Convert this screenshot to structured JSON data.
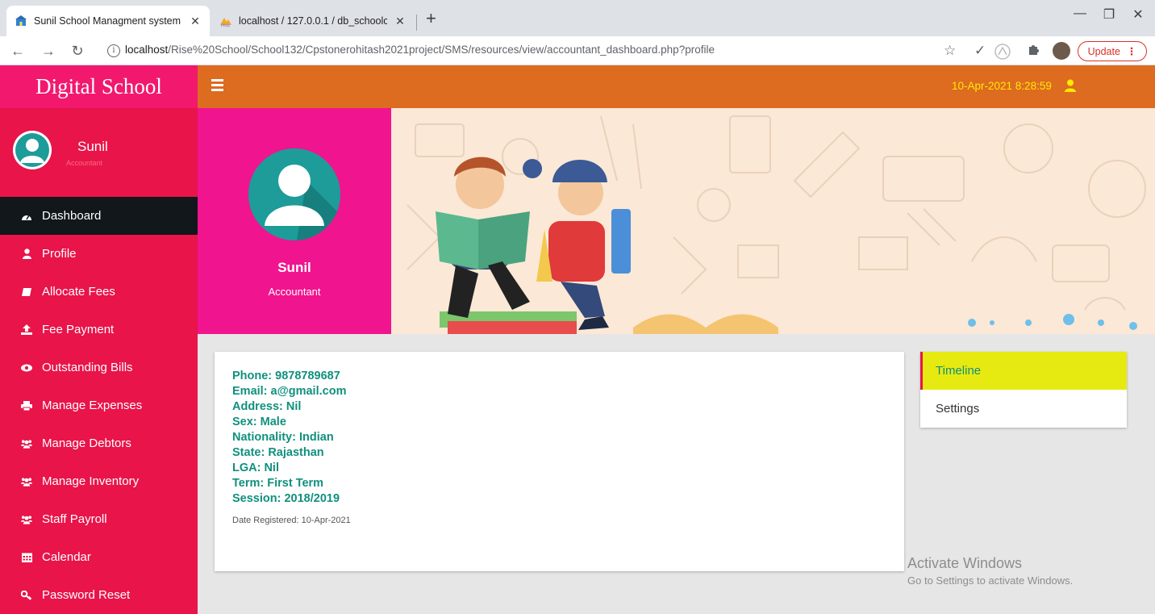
{
  "browser": {
    "tabs": [
      {
        "title": "Sunil School Managment system",
        "favicon": "school-icon",
        "active": true
      },
      {
        "title": "localhost / 127.0.0.1 / db_schoolc",
        "favicon": "phpmyadmin-icon",
        "active": false
      }
    ],
    "url_host": "localhost",
    "url_path": "/Rise%20School/School132/Cpstonerohitash2021project/SMS/resources/view/accountant_dashboard.php?profile",
    "update_label": "Update"
  },
  "app": {
    "brand": "Digital School",
    "datetime": "10-Apr-2021 8:28:59",
    "colors": {
      "brand": "#f2186e",
      "topbar": "#dd6b20",
      "sidebar": "#e8144a",
      "accent": "#10907d",
      "datetime": "#ffea00"
    }
  },
  "sidebar": {
    "user_name": "Sunil",
    "user_role": "Accountant",
    "items": [
      {
        "label": "Dashboard",
        "icon": "dashboard-icon",
        "active": true
      },
      {
        "label": "Profile",
        "icon": "user-icon"
      },
      {
        "label": "Allocate Fees",
        "icon": "book-icon"
      },
      {
        "label": "Fee Payment",
        "icon": "upload-icon"
      },
      {
        "label": "Outstanding Bills",
        "icon": "eye-icon"
      },
      {
        "label": "Manage Expenses",
        "icon": "print-icon"
      },
      {
        "label": "Manage Debtors",
        "icon": "users-icon"
      },
      {
        "label": "Manage Inventory",
        "icon": "users-icon"
      },
      {
        "label": "Staff Payroll",
        "icon": "users-icon"
      },
      {
        "label": "Calendar",
        "icon": "calendar-icon"
      },
      {
        "label": "Password Reset",
        "icon": "key-icon"
      }
    ]
  },
  "profile": {
    "name": "Sunil",
    "role": "Accountant",
    "details": [
      "Phone: 9878789687",
      "Email: a@gmail.com",
      "Address: Nil",
      "Sex: Male",
      "Nationality: Indian",
      "State: Rajasthan",
      "LGA: Nil",
      "Term: First Term",
      "Session: 2018/2019"
    ],
    "date_registered": "Date Registered: 10-Apr-2021"
  },
  "right_tabs": [
    "Timeline",
    "Settings"
  ],
  "watermark": {
    "title": "Activate Windows",
    "subtitle": "Go to Settings to activate Windows."
  }
}
